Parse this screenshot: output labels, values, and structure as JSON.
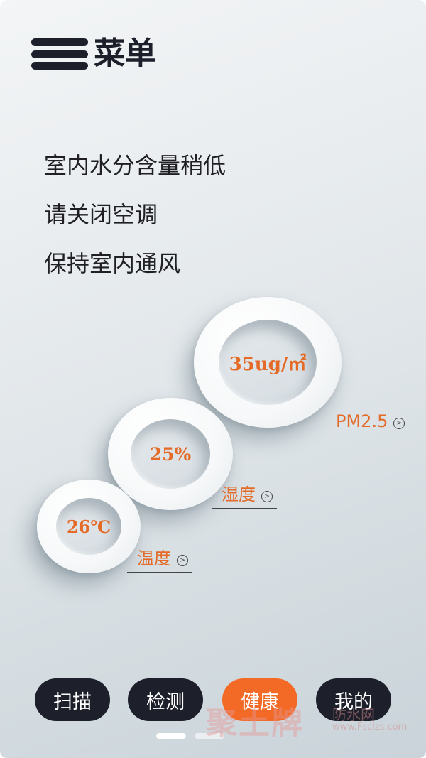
{
  "header": {
    "menu_icon": "hamburger-icon",
    "title": "菜单"
  },
  "messages": [
    "室内水分含量稍低",
    "请关闭空调",
    "保持室内通风"
  ],
  "metrics": {
    "pm25": {
      "value": "35ug/㎡",
      "label": "PM2.5"
    },
    "humidity": {
      "value": "25%",
      "label": "湿度"
    },
    "temperature": {
      "value": "26℃",
      "label": "温度"
    }
  },
  "nav": {
    "scan": "扫描",
    "detect": "检测",
    "health": "健康",
    "mine": "我的",
    "active": "health"
  },
  "colors": {
    "accent": "#e46a27",
    "nav_dark": "#1d1f2a",
    "nav_active": "#f26a26"
  },
  "watermark": {
    "main": "聚土牌",
    "sub": "防水网",
    "url": "www.Fsclzs.com"
  }
}
